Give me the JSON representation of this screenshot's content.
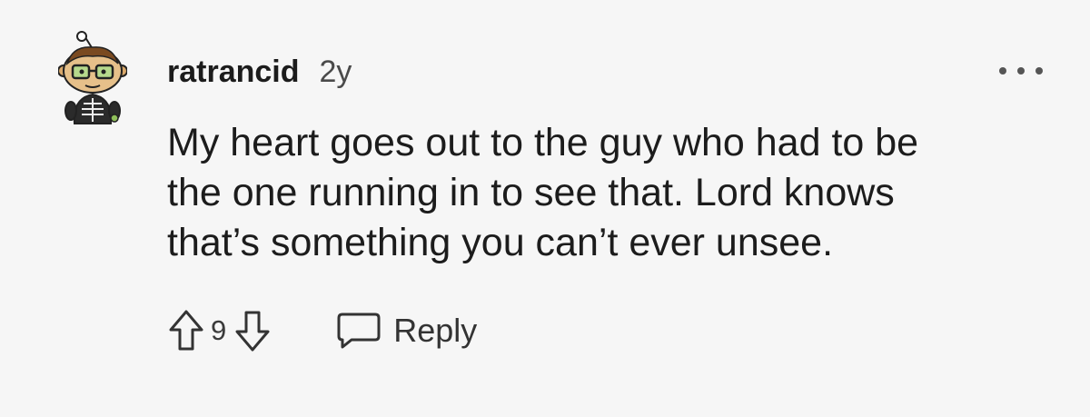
{
  "comment": {
    "author": "ratrancid",
    "age": "2y",
    "text_lines": [
      "My heart goes out to the guy who had to be",
      "the one running in to see that. Lord knows",
      "that’s something you can’t ever unsee."
    ],
    "score": "9",
    "reply_label": "Reply"
  },
  "icons": {
    "avatar": "snoo-avatar-icon",
    "more": "more-options-icon",
    "upvote": "upvote-arrow-icon",
    "downvote": "downvote-arrow-icon",
    "reply": "speech-bubble-icon"
  },
  "colors": {
    "background": "#f6f6f6",
    "text": "#1c1c1c",
    "muted": "#4a4a4a"
  }
}
